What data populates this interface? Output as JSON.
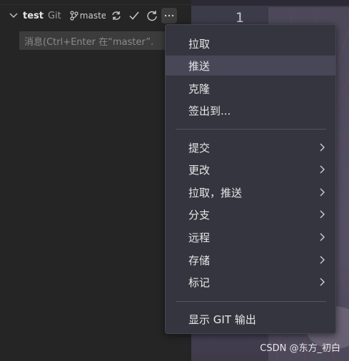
{
  "scm": {
    "repo_name": "test",
    "repo_kind": "Git",
    "branch": "maste",
    "icons": {
      "expand": "chevron-down-icon",
      "branch": "git-branch-icon",
      "sync": "sync-icon",
      "commit": "check-icon",
      "refresh": "refresh-icon",
      "more": "ellipsis-icon"
    },
    "message_placeholder": "消息(Ctrl+Enter 在“master”."
  },
  "editor": {
    "line_number": "1"
  },
  "menu": {
    "group1": [
      {
        "label": "拉取",
        "highlighted": false
      },
      {
        "label": "推送",
        "highlighted": true
      },
      {
        "label": "克隆",
        "highlighted": false
      },
      {
        "label": "签出到...",
        "highlighted": false
      }
    ],
    "group2": [
      {
        "label": "提交",
        "submenu": true
      },
      {
        "label": "更改",
        "submenu": true
      },
      {
        "label": "拉取，推送",
        "submenu": true
      },
      {
        "label": "分支",
        "submenu": true
      },
      {
        "label": "远程",
        "submenu": true
      },
      {
        "label": "存储",
        "submenu": true
      },
      {
        "label": "标记",
        "submenu": true
      }
    ],
    "group3": [
      {
        "label": "显示 GIT 输出",
        "submenu": false
      }
    ]
  },
  "watermark": "CSDN @东方_初白",
  "colors": {
    "menu_bg": "#35353f",
    "menu_highlight": "#474758",
    "panel_bg": "#252526"
  }
}
